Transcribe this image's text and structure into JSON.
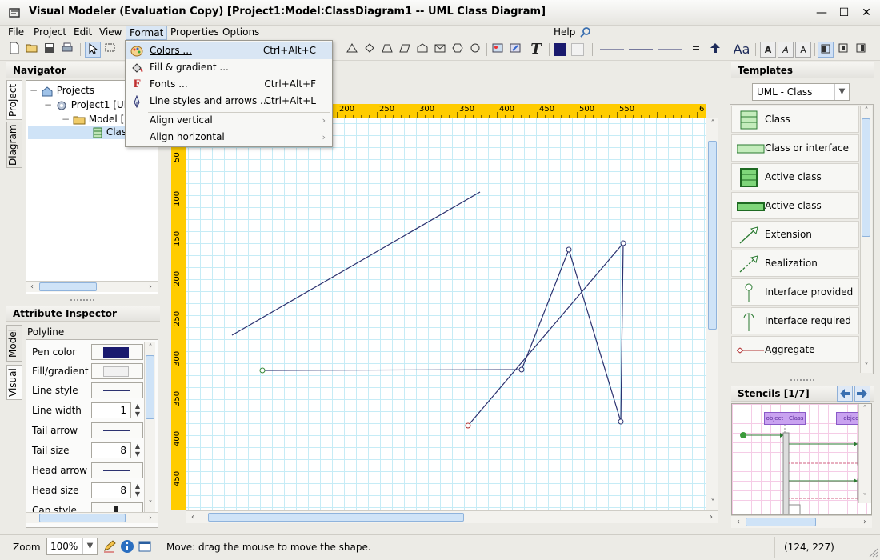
{
  "window": {
    "title": "Visual Modeler  (Evaluation Copy) [Project1:Model:ClassDiagram1 -- UML Class Diagram]",
    "minimize": "—",
    "maximize": "☐",
    "close": "✕"
  },
  "menu": {
    "items": [
      "File",
      "Project",
      "Edit",
      "View",
      "Format",
      "Properties",
      "Options"
    ],
    "help": "Help",
    "help_icon": "search-icon"
  },
  "format_menu": {
    "items": [
      {
        "label": "Colors ...",
        "accel": "Ctrl+Alt+C",
        "icon": "palette-icon"
      },
      {
        "label": "Fill & gradient ...",
        "accel": "",
        "icon": "fill-bucket-icon"
      },
      {
        "label": "Fonts ...",
        "accel": "Ctrl+Alt+F",
        "icon": "fonts-icon"
      },
      {
        "label": "Line styles and arrows ...",
        "accel": "Ctrl+Alt+L",
        "icon": "pen-icon"
      }
    ],
    "submenus": [
      {
        "label": "Align vertical"
      },
      {
        "label": "Align horizontal"
      }
    ]
  },
  "toolbar": {
    "text_tool": "T",
    "font_tool": "Aa",
    "letter_buttons": [
      "A",
      "A",
      "A"
    ]
  },
  "navigator": {
    "title": "Navigator",
    "tabs": [
      "Project",
      "Diagram"
    ],
    "tree": [
      {
        "label": "Projects",
        "expander": "−"
      },
      {
        "label": "Project1 [Ul",
        "expander": "−"
      },
      {
        "label": "Model [",
        "expander": "−"
      },
      {
        "label": "Clas",
        "expander": ""
      }
    ]
  },
  "inspector": {
    "title": "Attribute Inspector",
    "tabs": [
      "Model",
      "Visual"
    ],
    "object": "Polyline",
    "rows": [
      {
        "label": "Pen color",
        "kind": "color",
        "value": "#1a1a6e"
      },
      {
        "label": "Fill/gradient",
        "kind": "fill",
        "value": ""
      },
      {
        "label": "Line style",
        "kind": "line",
        "value": ""
      },
      {
        "label": "Line width",
        "kind": "spin",
        "value": "1"
      },
      {
        "label": "Tail arrow",
        "kind": "line",
        "value": ""
      },
      {
        "label": "Tail size",
        "kind": "spin",
        "value": "8"
      },
      {
        "label": "Head arrow",
        "kind": "line",
        "value": ""
      },
      {
        "label": "Head size",
        "kind": "spin",
        "value": "8"
      },
      {
        "label": "Cap style",
        "kind": "cap",
        "value": ""
      }
    ]
  },
  "ruler": {
    "top_labels": [
      "200",
      "250",
      "300",
      "350",
      "400",
      "450",
      "500",
      "550",
      "6"
    ],
    "left_labels": [
      "50",
      "100",
      "150",
      "200",
      "250",
      "300",
      "350",
      "400",
      "450"
    ]
  },
  "canvas": {
    "line_color": "#2c3270"
  },
  "templates": {
    "title": "Templates",
    "selector": "UML - Class",
    "items": [
      {
        "label": "Class",
        "icon": "class-icon"
      },
      {
        "label": "Class or interface",
        "icon": "class-or-interface-icon"
      },
      {
        "label": "Active class",
        "icon": "active-class-icon"
      },
      {
        "label": "Active class",
        "icon": "active-class-flat-icon"
      },
      {
        "label": "Extension",
        "icon": "extension-arrow-icon"
      },
      {
        "label": "Realization",
        "icon": "realization-arrow-icon"
      },
      {
        "label": "Interface provided",
        "icon": "interface-provided-icon"
      },
      {
        "label": "Interface required",
        "icon": "interface-required-icon"
      },
      {
        "label": "Aggregate",
        "icon": "aggregate-icon"
      }
    ]
  },
  "stencils": {
    "title": "Stencils [1/7]",
    "preview_labels": [
      "object : Class",
      "object"
    ]
  },
  "statusbar": {
    "zoom_label": "Zoom",
    "zoom_value": "100%",
    "message": "Move: drag the mouse to move the shape.",
    "coords": "(124, 227)"
  }
}
